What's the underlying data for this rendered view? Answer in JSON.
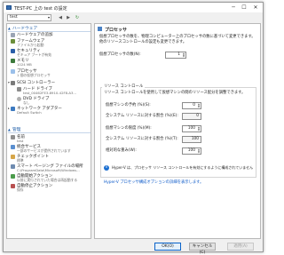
{
  "window": {
    "title": "TEST-PC 上の test の設定",
    "controls": {
      "minimize": "─",
      "maximize": "☐",
      "close": "✕"
    }
  },
  "toolbar": {
    "vm_name": "test",
    "back": "◀",
    "forward": "▶",
    "refresh": "↻"
  },
  "sidebar": {
    "hardware_header": "ハードウェア",
    "management_header": "管理",
    "items": [
      {
        "label": "ハードウェアの追加",
        "sub": ""
      },
      {
        "label": "ファームウェア",
        "sub": "ファイルから起動"
      },
      {
        "label": "セキュリティ",
        "sub": "セキュア ブートが有効"
      },
      {
        "label": "メモリ",
        "sub": "1024 MB"
      },
      {
        "label": "プロセッサ",
        "sub": "1 個の仮想プロセッサ"
      },
      {
        "label": "SCSI コントローラー",
        "sub": ""
      },
      {
        "label": "ハード ドライブ",
        "sub": "test_00462FE3-8910-42F8-A3..."
      },
      {
        "label": "DVD ドライブ",
        "sub": "なし"
      },
      {
        "label": "ネットワーク アダプター",
        "sub": "Default Switch"
      },
      {
        "label": "名前",
        "sub": "test"
      },
      {
        "label": "統合サービス",
        "sub": "一部のサービスが提供されています"
      },
      {
        "label": "チェックポイント",
        "sub": "標準"
      },
      {
        "label": "スマート ページング ファイルの場所",
        "sub": "C:\\ProgramData\\Microsoft\\Windows..."
      },
      {
        "label": "自動開始アクション",
        "sub": "以前に実行されていた場合は再起動する"
      },
      {
        "label": "自動停止アクション",
        "sub": "保存"
      }
    ]
  },
  "processor": {
    "title": "プロセッサ",
    "description": "仮想プロセッサの数を、物理コンピューター上のプロセッサの数に基づいて変更できます。他のリソースコントロールの設定も変更できます。",
    "count_label": "仮想プロセッサの数(N):",
    "count_value": "1",
    "resource_group": "リソース コントロール",
    "resource_desc": "リソース コントロールを使用して仮想マシンの間のリソース配分を調整できます。",
    "reserve_label": "仮想マシンの予約 (%)(S):",
    "reserve_value": "0",
    "reserve_pct_label": "全システム リソースに対する割合 (%)(E):",
    "reserve_pct_value": "0",
    "limit_label": "仮想マシンの限度 (%)(M):",
    "limit_value": "100",
    "limit_pct_label": "全システム リソースに対する割合 (%)(T):",
    "limit_pct_value": "100",
    "weight_label": "相対的な重み(W):",
    "weight_value": "100",
    "info_text": "Hyper-V は、プロセッサ リソース コントロールを有効にするように構成されていません",
    "link_text": "Hyper-V プロセッサ構成オプションの詳細を表示します。"
  },
  "buttons": {
    "ok": "OK(O)",
    "cancel": "キャンセル(C)",
    "apply": "適用(A)"
  }
}
